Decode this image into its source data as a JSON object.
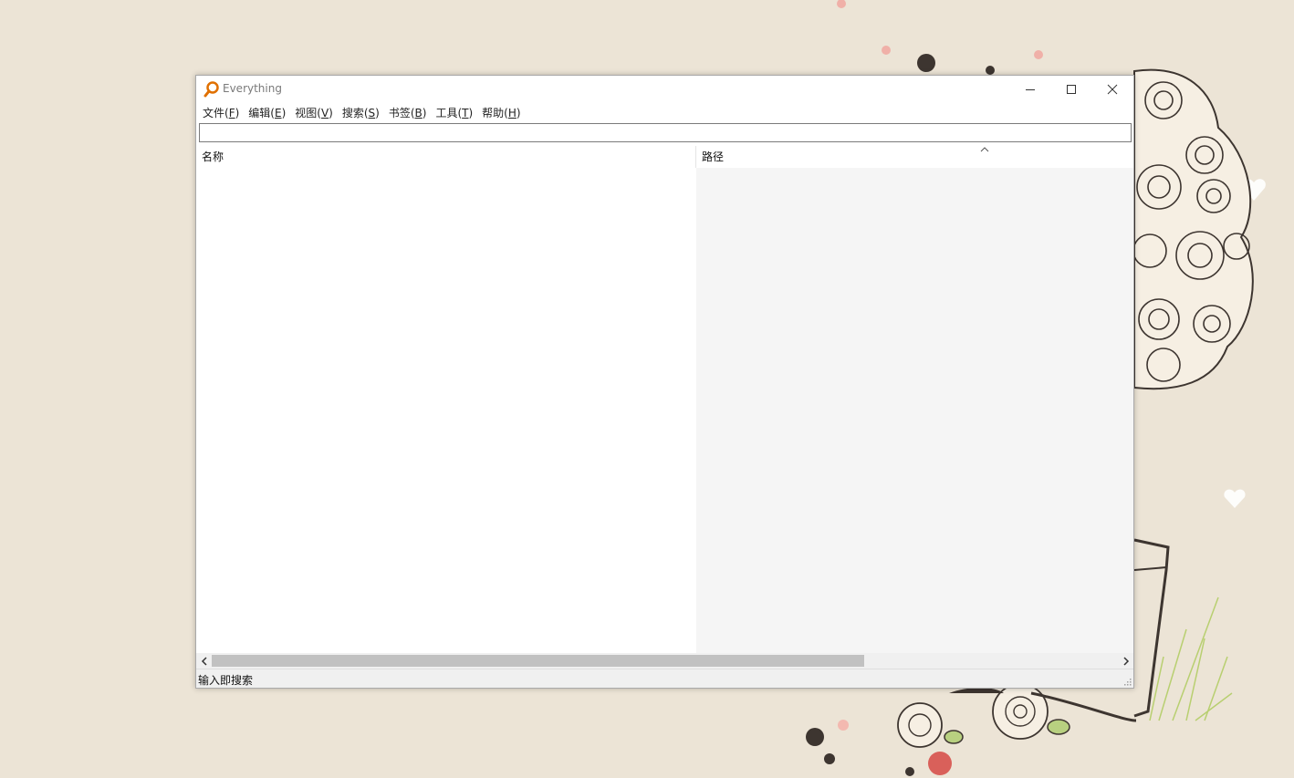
{
  "window": {
    "title": "Everything",
    "icon": "magnifier-icon",
    "controls": {
      "minimize_icon": "minimize-icon",
      "maximize_icon": "maximize-icon",
      "close_icon": "close-icon"
    }
  },
  "menubar": {
    "items": [
      {
        "label": "文件(",
        "accel": "F",
        "tail": ")"
      },
      {
        "label": "编辑(",
        "accel": "E",
        "tail": ")"
      },
      {
        "label": "视图(",
        "accel": "V",
        "tail": ")"
      },
      {
        "label": "搜索(",
        "accel": "S",
        "tail": ")"
      },
      {
        "label": "书签(",
        "accel": "B",
        "tail": ")"
      },
      {
        "label": "工具(",
        "accel": "T",
        "tail": ")"
      },
      {
        "label": "帮助(",
        "accel": "H",
        "tail": ")"
      }
    ]
  },
  "search": {
    "value": ""
  },
  "columns": {
    "name": "名称",
    "path": "路径",
    "sorted_indicator": "chevron-up-icon"
  },
  "status": {
    "text": "输入即搜索"
  },
  "colors": {
    "desktop_bg": "#ece4d6",
    "window_bg": "#ffffff",
    "path_column_bg": "#f5f5f5",
    "scrollbar_thumb": "#c1c1c1",
    "app_icon_accent": "#e07000"
  }
}
